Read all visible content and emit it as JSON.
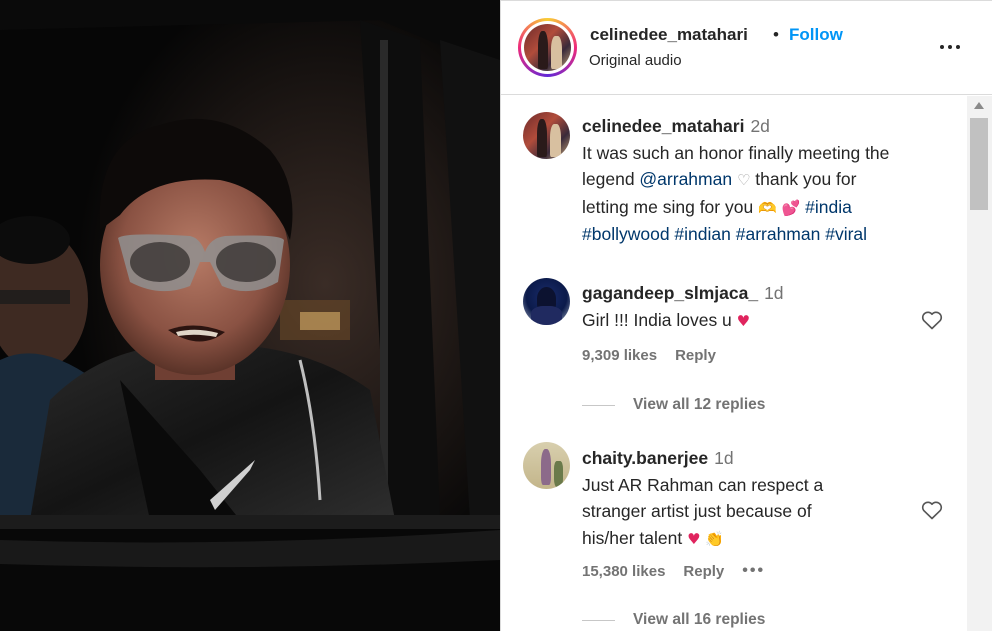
{
  "post_header": {
    "username": "celinedee_matahari",
    "separator": "•",
    "follow_label": "Follow",
    "audio_label": "Original audio"
  },
  "comments": [
    {
      "username": "celinedee_matahari",
      "time": "2d",
      "lines": [
        [
          "It was such an honor finally meeting the"
        ],
        [
          "legend ",
          "@arrahman",
          " ",
          " thank you for"
        ],
        [
          "letting me sing for you ",
          " ",
          " #india"
        ],
        [
          "#bollywood #indian #arrahman #viral"
        ]
      ],
      "emojis": {
        "white_heart": "♡",
        "heart_hands": "🫶",
        "two_hearts": "💕"
      }
    },
    {
      "username": "gagandeep_slmjaca_",
      "time": "1d",
      "text": "Girl !!! India loves u",
      "emoji": "♥",
      "likes": "9,309 likes",
      "reply_label": "Reply",
      "view_replies": "View all 12 replies"
    },
    {
      "username": "chaity.banerjee",
      "time": "1d",
      "lines": [
        "Just AR Rahman can respect a",
        "stranger artist just because of",
        "his/her talent"
      ],
      "emoji_heart": "♥",
      "emoji_clap": "👏",
      "likes": "15,380 likes",
      "reply_label": "Reply",
      "more": "•••",
      "view_replies": "View all 16 replies"
    }
  ],
  "icons": {
    "more_options": "ellipsis-icon",
    "like": "heart-outline-icon",
    "scroll_up": "scroll-up-arrow-icon"
  },
  "colors": {
    "follow_blue": "#0095f6",
    "hashtag": "#00376b",
    "secondary_text": "#737373",
    "heart_red": "#e0245e"
  }
}
